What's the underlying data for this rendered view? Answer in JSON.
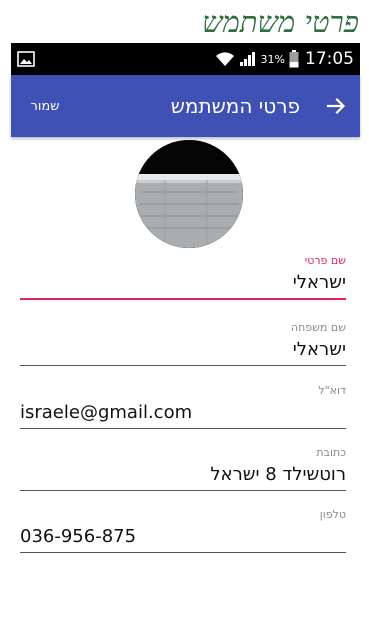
{
  "caption": {
    "title": "פרטי משתמש"
  },
  "statusbar": {
    "battery_percent": "31%",
    "time": "17:05",
    "icons": [
      "image-icon",
      "wifi-icon",
      "signal-icon",
      "battery-icon"
    ]
  },
  "appbar": {
    "title": "פרטי המשתמש",
    "save_label": "שמור",
    "back_icon": "arrow-right-icon",
    "color": "#3f51b5"
  },
  "profile": {
    "avatar": "profile-photo"
  },
  "form": {
    "accent_color": "#e91e63",
    "fields": [
      {
        "label": "שם פרטי",
        "value": "ישראלי"
      },
      {
        "label": "שם משפחה",
        "value": "ישראלי"
      },
      {
        "label": "דוא\"ל",
        "value": "israele@gmail.com"
      },
      {
        "label": "כתובת",
        "value": "רוטשילד 8 ישראל"
      },
      {
        "label": "טלפון",
        "value": "036-956-875"
      }
    ]
  }
}
